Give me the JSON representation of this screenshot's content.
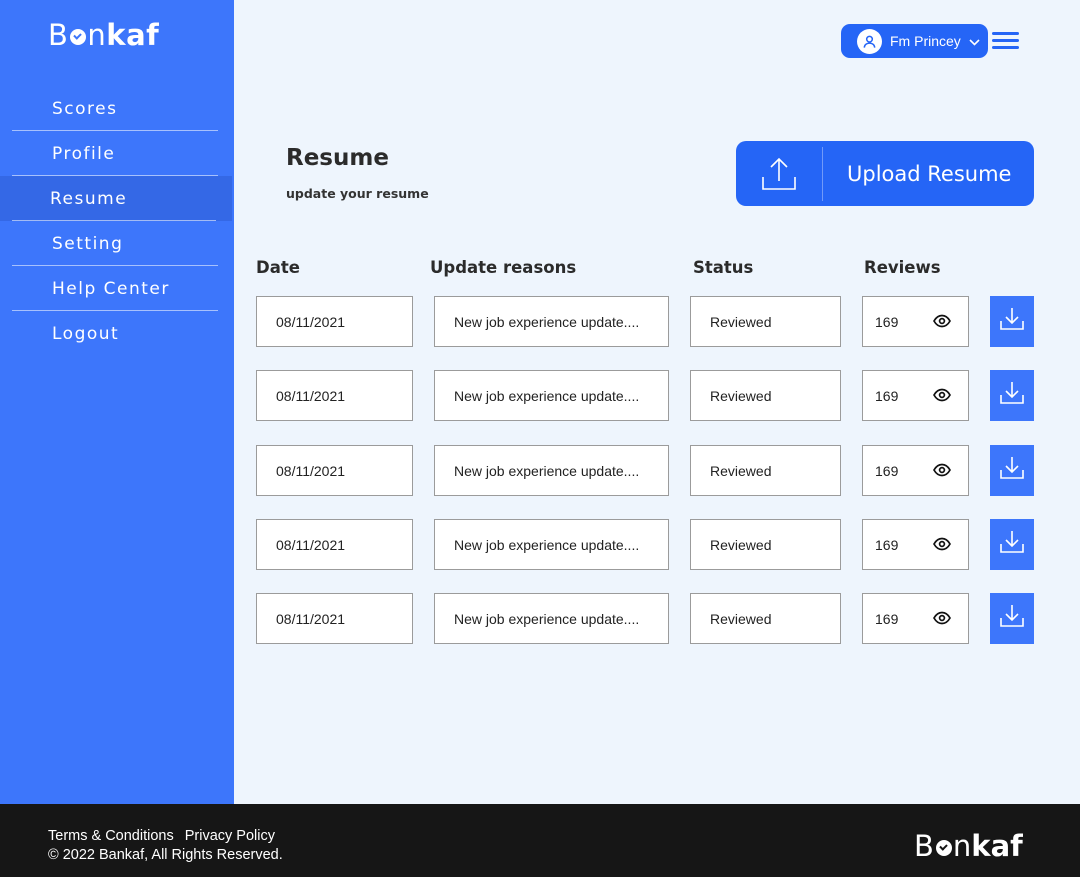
{
  "brand": {
    "prefix": "B",
    "middle": "n",
    "suffix": "kaf"
  },
  "sidebar": {
    "items": [
      {
        "label": "Scores"
      },
      {
        "label": "Profile"
      },
      {
        "label": "Resume",
        "active": true
      },
      {
        "label": "Setting"
      },
      {
        "label": "Help Center"
      },
      {
        "label": "Logout"
      }
    ]
  },
  "header": {
    "user_name": "Fm Princey"
  },
  "main": {
    "title": "Resume",
    "subtitle": "update your resume",
    "upload_label": "Upload Resume",
    "columns": [
      "Date",
      "Update reasons",
      "Status",
      "Reviews"
    ],
    "rows": [
      {
        "date": "08/11/2021",
        "reason": "New job experience update....",
        "status": "Reviewed",
        "reviews": "169"
      },
      {
        "date": "08/11/2021",
        "reason": "New job experience update....",
        "status": "Reviewed",
        "reviews": "169"
      },
      {
        "date": "08/11/2021",
        "reason": "New job experience update....",
        "status": "Reviewed",
        "reviews": "169"
      },
      {
        "date": "08/11/2021",
        "reason": "New job experience update....",
        "status": "Reviewed",
        "reviews": "169"
      },
      {
        "date": "08/11/2021",
        "reason": "New job experience update....",
        "status": "Reviewed",
        "reviews": "169"
      }
    ]
  },
  "footer": {
    "terms": "Terms & Conditions",
    "privacy": "Privacy Policy",
    "copyright": "© 2022 Bankaf, All Rights Reserved."
  },
  "colors": {
    "primary": "#3d76fb",
    "button": "#2565f6",
    "background": "#eef5fd",
    "footer": "#161616"
  },
  "icons": [
    "user-icon",
    "chevron-down-icon",
    "hamburger-menu-icon",
    "upload-icon",
    "eye-icon",
    "download-icon"
  ]
}
